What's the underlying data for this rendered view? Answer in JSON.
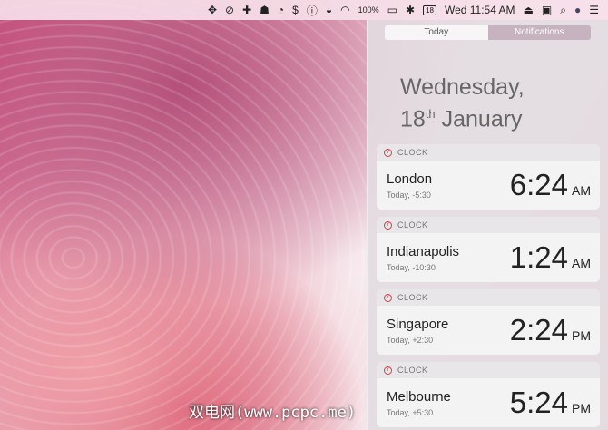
{
  "menubar": {
    "battery": "100%",
    "datetime": "Wed 11:54 AM",
    "calendar_day": "18",
    "icons": [
      "dropbox-icon",
      "sync-icon",
      "plus-icon",
      "bell-icon",
      "timer-icon",
      "dollar-icon",
      "info-icon",
      "cup-icon",
      "wifi-icon",
      "battery-icon",
      "bluetooth-icon",
      "calendar-icon",
      "airplay-icon",
      "window-icon",
      "search-icon",
      "avatar-icon",
      "list-icon"
    ]
  },
  "panel": {
    "tabs": [
      {
        "label": "Today"
      },
      {
        "label": "Notifications"
      }
    ],
    "date_line1": "Wednesday,",
    "date_day": "18",
    "date_suffix": "th",
    "date_month": "January",
    "widget_title": "CLOCK",
    "clocks": [
      {
        "city": "London",
        "offset": "Today, -5:30",
        "time": "6:24",
        "ampm": "AM"
      },
      {
        "city": "Indianapolis",
        "offset": "Today, -10:30",
        "time": "1:24",
        "ampm": "AM"
      },
      {
        "city": "Singapore",
        "offset": "Today, +2:30",
        "time": "2:24",
        "ampm": "PM"
      },
      {
        "city": "Melbourne",
        "offset": "Today, +5:30",
        "time": "5:24",
        "ampm": "PM"
      }
    ]
  },
  "watermark": "双电网(www.pcpc.me)"
}
